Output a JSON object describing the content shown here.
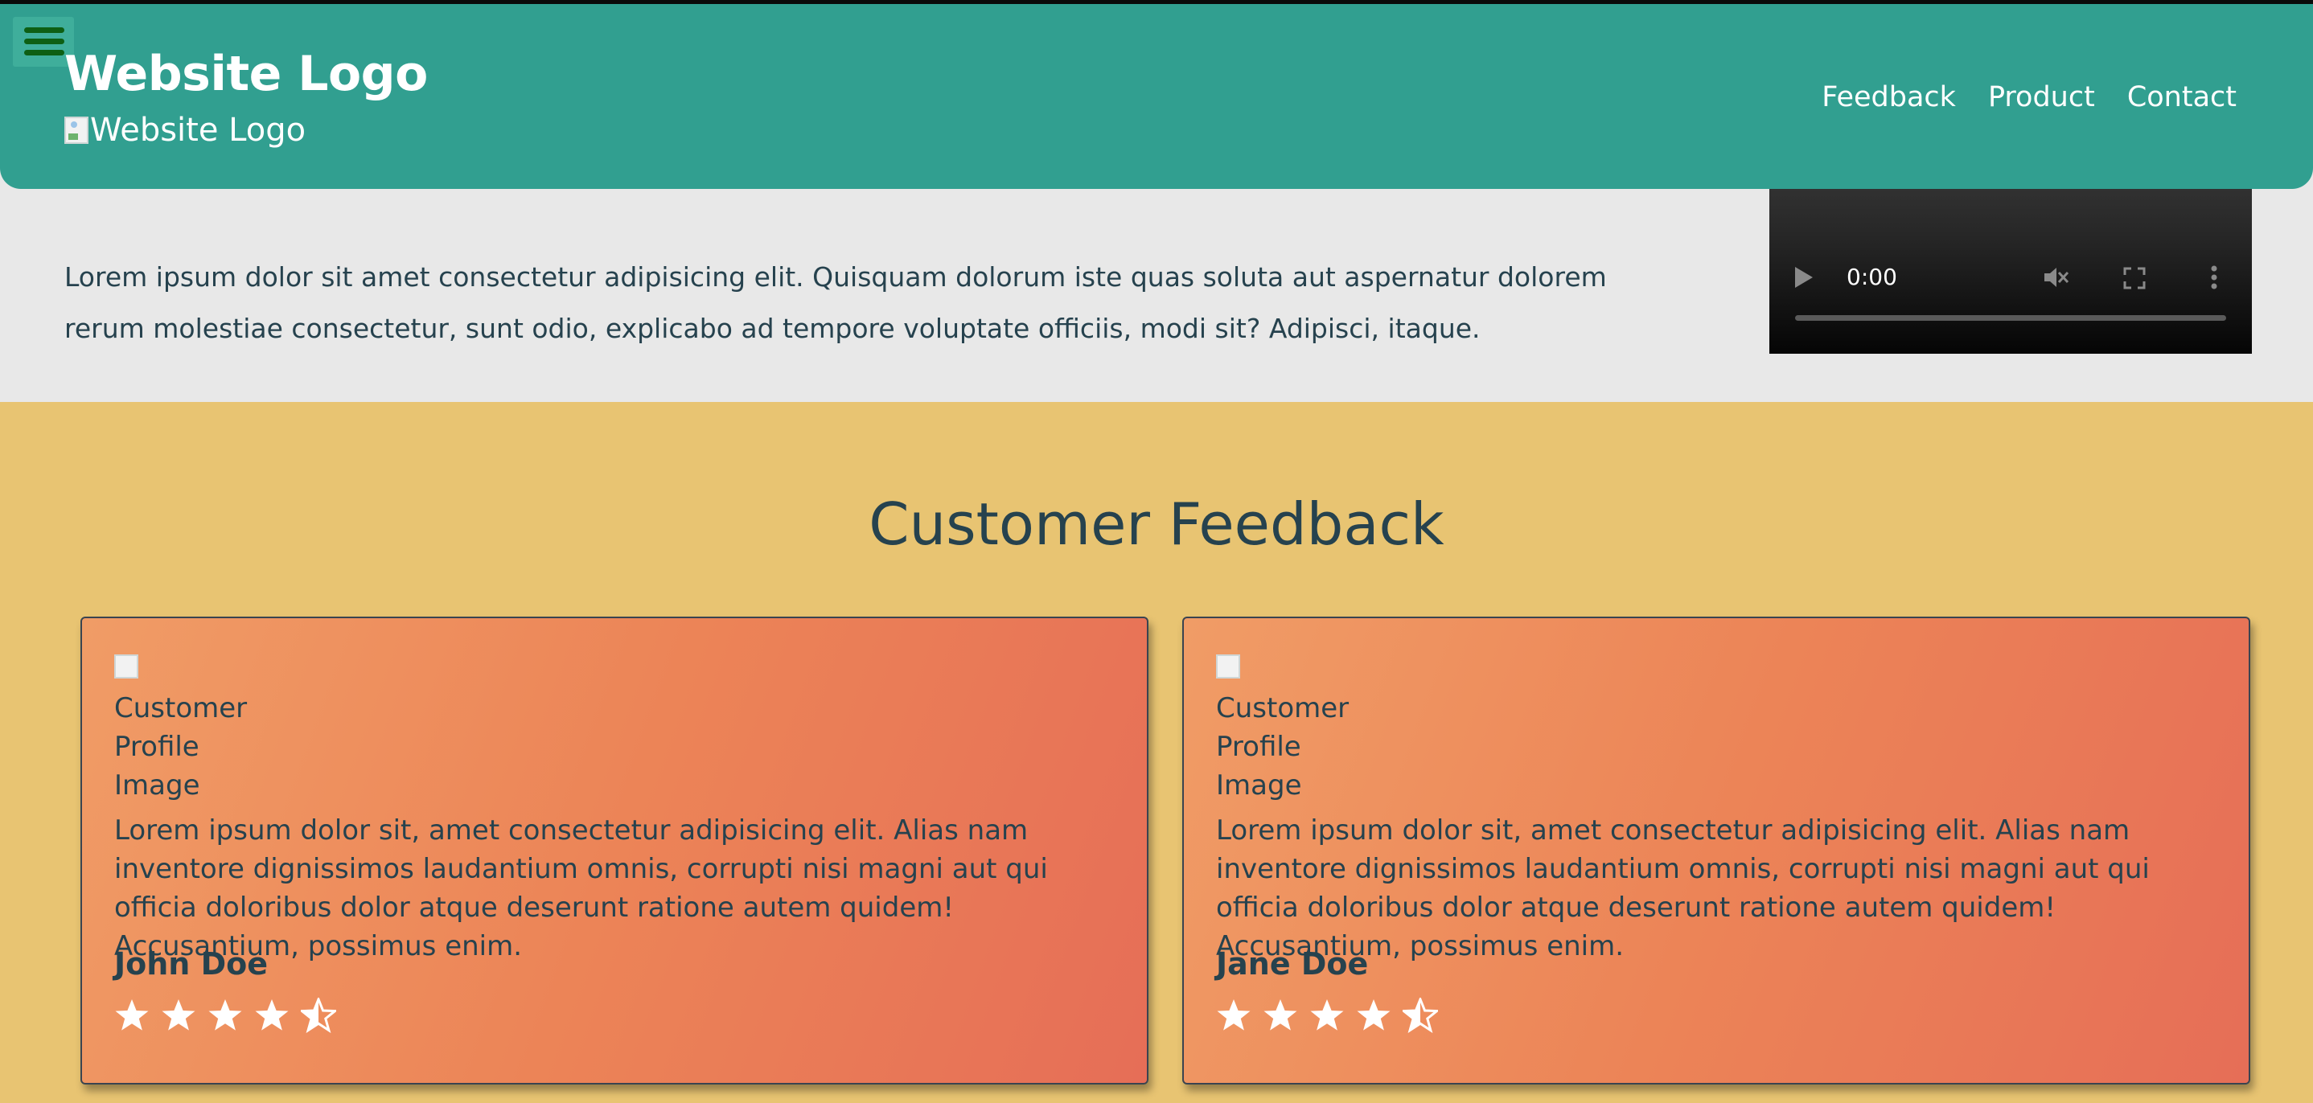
{
  "header": {
    "logo_text": "Website Logo",
    "logo_alt": "Website Logo",
    "nav": [
      "Feedback",
      "Product",
      "Contact"
    ]
  },
  "about": {
    "text": "Lorem ipsum dolor sit amet consectetur adipisicing elit. Quisquam dolorum iste quas soluta aut aspernatur dolorem rerum molestiae consectetur, sunt odio, explicabo ad tempore voluptate officiis, modi sit? Adipisci, itaque."
  },
  "video": {
    "time": "0:00"
  },
  "feedback": {
    "title": "Customer Feedback",
    "cards": [
      {
        "img_alt": "Customer Profile Image",
        "text": "Lorem ipsum dolor sit, amet consectetur adipisicing elit. Alias nam inventore dignissimos laudantium omnis, corrupti nisi magni aut qui officia doloribus dolor atque deserunt ratione autem quidem! Accusantium, possimus enim.",
        "name": "John Doe",
        "rating": 4.5
      },
      {
        "img_alt": "Customer Profile Image",
        "text": "Lorem ipsum dolor sit, amet consectetur adipisicing elit. Alias nam inventore dignissimos laudantium omnis, corrupti nisi magni aut qui officia doloribus dolor atque deserunt ratione autem quidem! Accusantium, possimus enim.",
        "name": "Jane Doe",
        "rating": 4.5
      }
    ]
  },
  "colors": {
    "header": "#319f90",
    "feedback_bg": "#e8c472",
    "text": "#26424e"
  },
  "icons": [
    "hamburger-menu-icon",
    "play-icon",
    "mute-icon",
    "fullscreen-icon",
    "more-options-icon",
    "star-icon",
    "half-star-icon"
  ]
}
